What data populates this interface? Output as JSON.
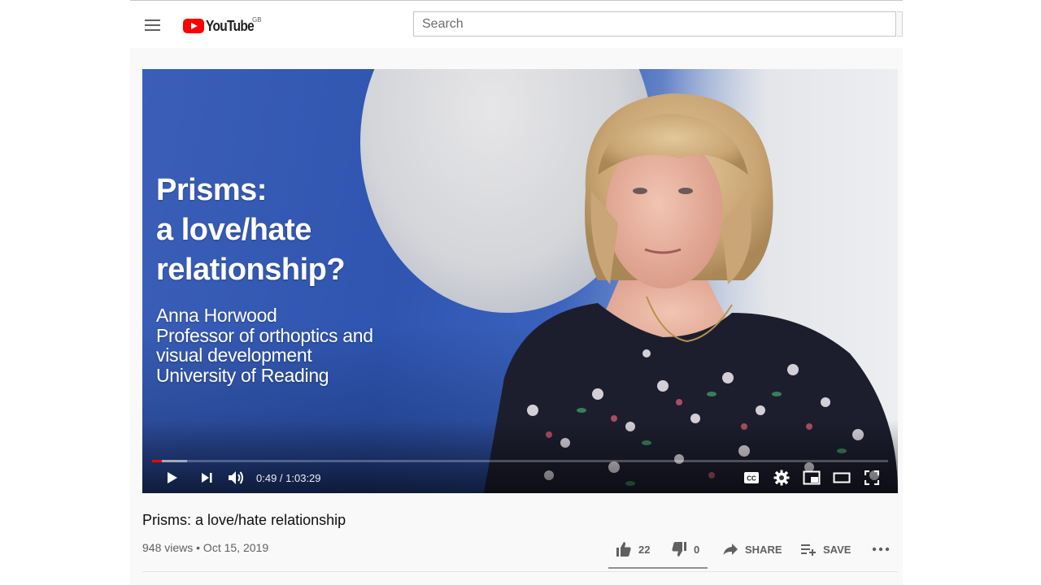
{
  "masthead": {
    "menu_icon": "hamburger-menu-icon",
    "logo_text": "YouTube",
    "logo_country": "GB",
    "search_placeholder": "Search"
  },
  "player": {
    "overlay_title_lines": [
      "Prisms:",
      "a love/hate",
      "relationship?"
    ],
    "overlay_subtitle_lines": [
      "Anna Horwood",
      "Professor of orthoptics and",
      "visual development",
      "University of Reading"
    ],
    "time_display": "0:49 / 1:03:29",
    "progress_played": 0.013,
    "progress_loaded": 0.047,
    "controls": {
      "left": [
        "play-icon",
        "next-icon",
        "volume-icon"
      ],
      "right": [
        "captions-icon",
        "settings-icon",
        "miniplayer-icon",
        "theater-mode-icon",
        "fullscreen-icon"
      ]
    }
  },
  "video": {
    "title": "Prisms: a love/hate relationship",
    "meta": "948 views • Oct 15, 2019",
    "likes": "22",
    "dislikes": "0",
    "share_label": "SHARE",
    "save_label": "SAVE"
  },
  "colors": {
    "brand_red": "#ff0000",
    "text_primary": "#0f0f0f",
    "text_secondary": "#606060"
  }
}
